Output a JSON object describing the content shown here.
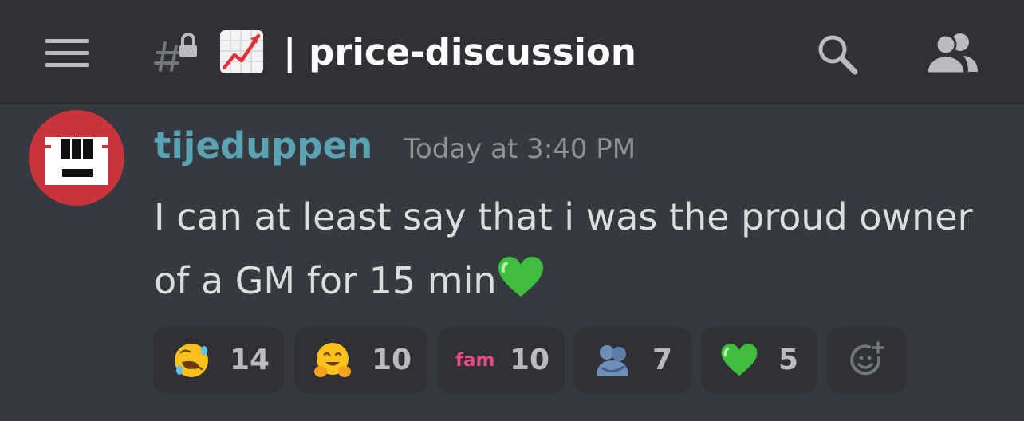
{
  "header": {
    "channel_emoji": "chart-increasing-icon",
    "channel_name": "| price-discussion",
    "icons": [
      "menu-icon",
      "locked-channel-icon",
      "search-icon",
      "members-icon"
    ]
  },
  "message": {
    "author": "tijeduppen",
    "author_color": "#5aa3b5",
    "timestamp": "Today at 3:40 PM",
    "text": "I can at least say that i was the proud owner of a GM for 15 min",
    "trailing_emoji": "green-heart-icon"
  },
  "reactions": [
    {
      "emoji": "rolling-on-floor-laughing-icon",
      "count": "14"
    },
    {
      "emoji": "hugging-face-icon",
      "count": "10"
    },
    {
      "emoji": "fam-icon",
      "label": "fam",
      "count": "10"
    },
    {
      "emoji": "people-hugging-icon",
      "count": "7"
    },
    {
      "emoji": "green-heart-icon",
      "count": "5"
    }
  ],
  "add_reaction_icon": "add-reaction-icon",
  "colors": {
    "background": "#36393f",
    "header": "#2f3136",
    "reaction_bg": "#2f3136",
    "avatar": "#c9343a",
    "fam_label": "#e84a8a"
  }
}
